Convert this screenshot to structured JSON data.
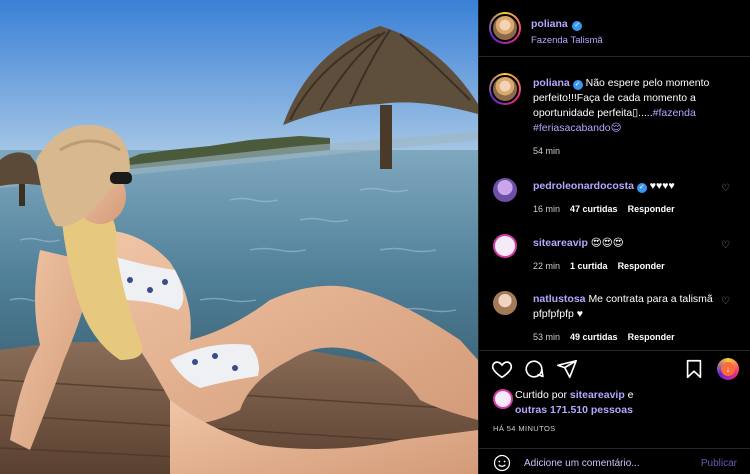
{
  "post": {
    "username": "poliana",
    "location": "Fazenda Talismã"
  },
  "caption": {
    "username": "poliana",
    "text": "Não espere pelo momento perfeito!!!Faça de cada momento a oportunidade perfeita\u0000.....",
    "text_display": "Não espere pelo momento perfeito!!!Faça de cada momento a oportunidade perfeita▯.....",
    "tag1": "#fazenda",
    "tag2": "#feriasacabando",
    "emoji": "😌",
    "time": "54 min"
  },
  "comments": [
    {
      "username": "pedroleonardocosta",
      "verified": true,
      "text": "♥♥♥♥",
      "time": "16 min",
      "likes": "47 curtidas",
      "reply": "Responder"
    },
    {
      "username": "siteareavip",
      "verified": false,
      "text": "😍😍😍",
      "time": "22 min",
      "likes": "1 curtida",
      "reply": "Responder"
    },
    {
      "username": "natlustosa",
      "verified": false,
      "text": "Me contrata para a talismã pfpfpfpfp ♥",
      "time": "53 min",
      "likes": "49 curtidas",
      "reply": "Responder"
    }
  ],
  "liked_by": {
    "prefix": "Curtido por",
    "user": "siteareavip",
    "suffix": "e",
    "others": "outras 171.510 pessoas"
  },
  "post_time": "HÁ 54 MINUTOS",
  "composer": {
    "placeholder": "Adicione um comentário...",
    "publish": "Publicar"
  },
  "icons": {
    "like": "heart-icon",
    "comment": "comment-icon",
    "share": "share-icon",
    "save": "bookmark-icon",
    "emoji": "emoji-icon"
  },
  "colors": {
    "link": "#b8a6ff",
    "verified": "#3897f0",
    "background": "#000000"
  }
}
